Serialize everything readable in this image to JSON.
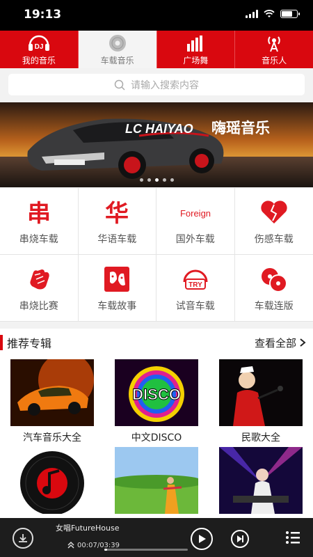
{
  "status": {
    "time": "19:13"
  },
  "tabs": [
    {
      "label": "我的音乐",
      "icon": "dj-headphones-icon"
    },
    {
      "label": "车载音乐",
      "icon": "disc-icon"
    },
    {
      "label": "广场舞",
      "icon": "bar-chart-icon"
    },
    {
      "label": "音乐人",
      "icon": "broadcast-tower-icon"
    }
  ],
  "active_tab": "车载音乐",
  "search": {
    "placeholder": "请输入搜索内容"
  },
  "banner": {
    "brand": "LC HAIYAO",
    "slogan": "嗨瑶音乐",
    "slide_count": 5,
    "active_slide": 2
  },
  "categories": [
    {
      "label": "串烧车载",
      "icon": "skewer-icon",
      "glyph": "串"
    },
    {
      "label": "华语车载",
      "icon": "chinese-char-icon",
      "glyph": "华"
    },
    {
      "label": "国外车载",
      "icon": "foreign-text-icon",
      "glyph": "Foreign"
    },
    {
      "label": "伤感车载",
      "icon": "broken-heart-icon"
    },
    {
      "label": "串烧比赛",
      "icon": "fist-icon"
    },
    {
      "label": "车载故事",
      "icon": "faces-icon"
    },
    {
      "label": "试音车载",
      "icon": "try-headphones-icon",
      "glyph": "TRY"
    },
    {
      "label": "车载连版",
      "icon": "discs-icon"
    }
  ],
  "section": {
    "title": "推荐专辑",
    "more": "查看全部"
  },
  "albums": [
    {
      "title": "汽车音乐大全",
      "cover": "orange-sports-car"
    },
    {
      "title": "中文DISCO",
      "cover": "disco-lights",
      "cover_text": "DISCO"
    },
    {
      "title": "民歌大全",
      "cover": "folk-singer"
    },
    {
      "title": "",
      "cover": "vinyl-note"
    },
    {
      "title": "",
      "cover": "meadow-dancer"
    },
    {
      "title": "",
      "cover": "dj-purple-lights"
    }
  ],
  "player": {
    "song": "女唱FutureHouse",
    "time": "00:07/03:39",
    "progress": 0.03
  },
  "colors": {
    "brand_red": "#d9080f",
    "player_bg": "#1d1d1d"
  }
}
